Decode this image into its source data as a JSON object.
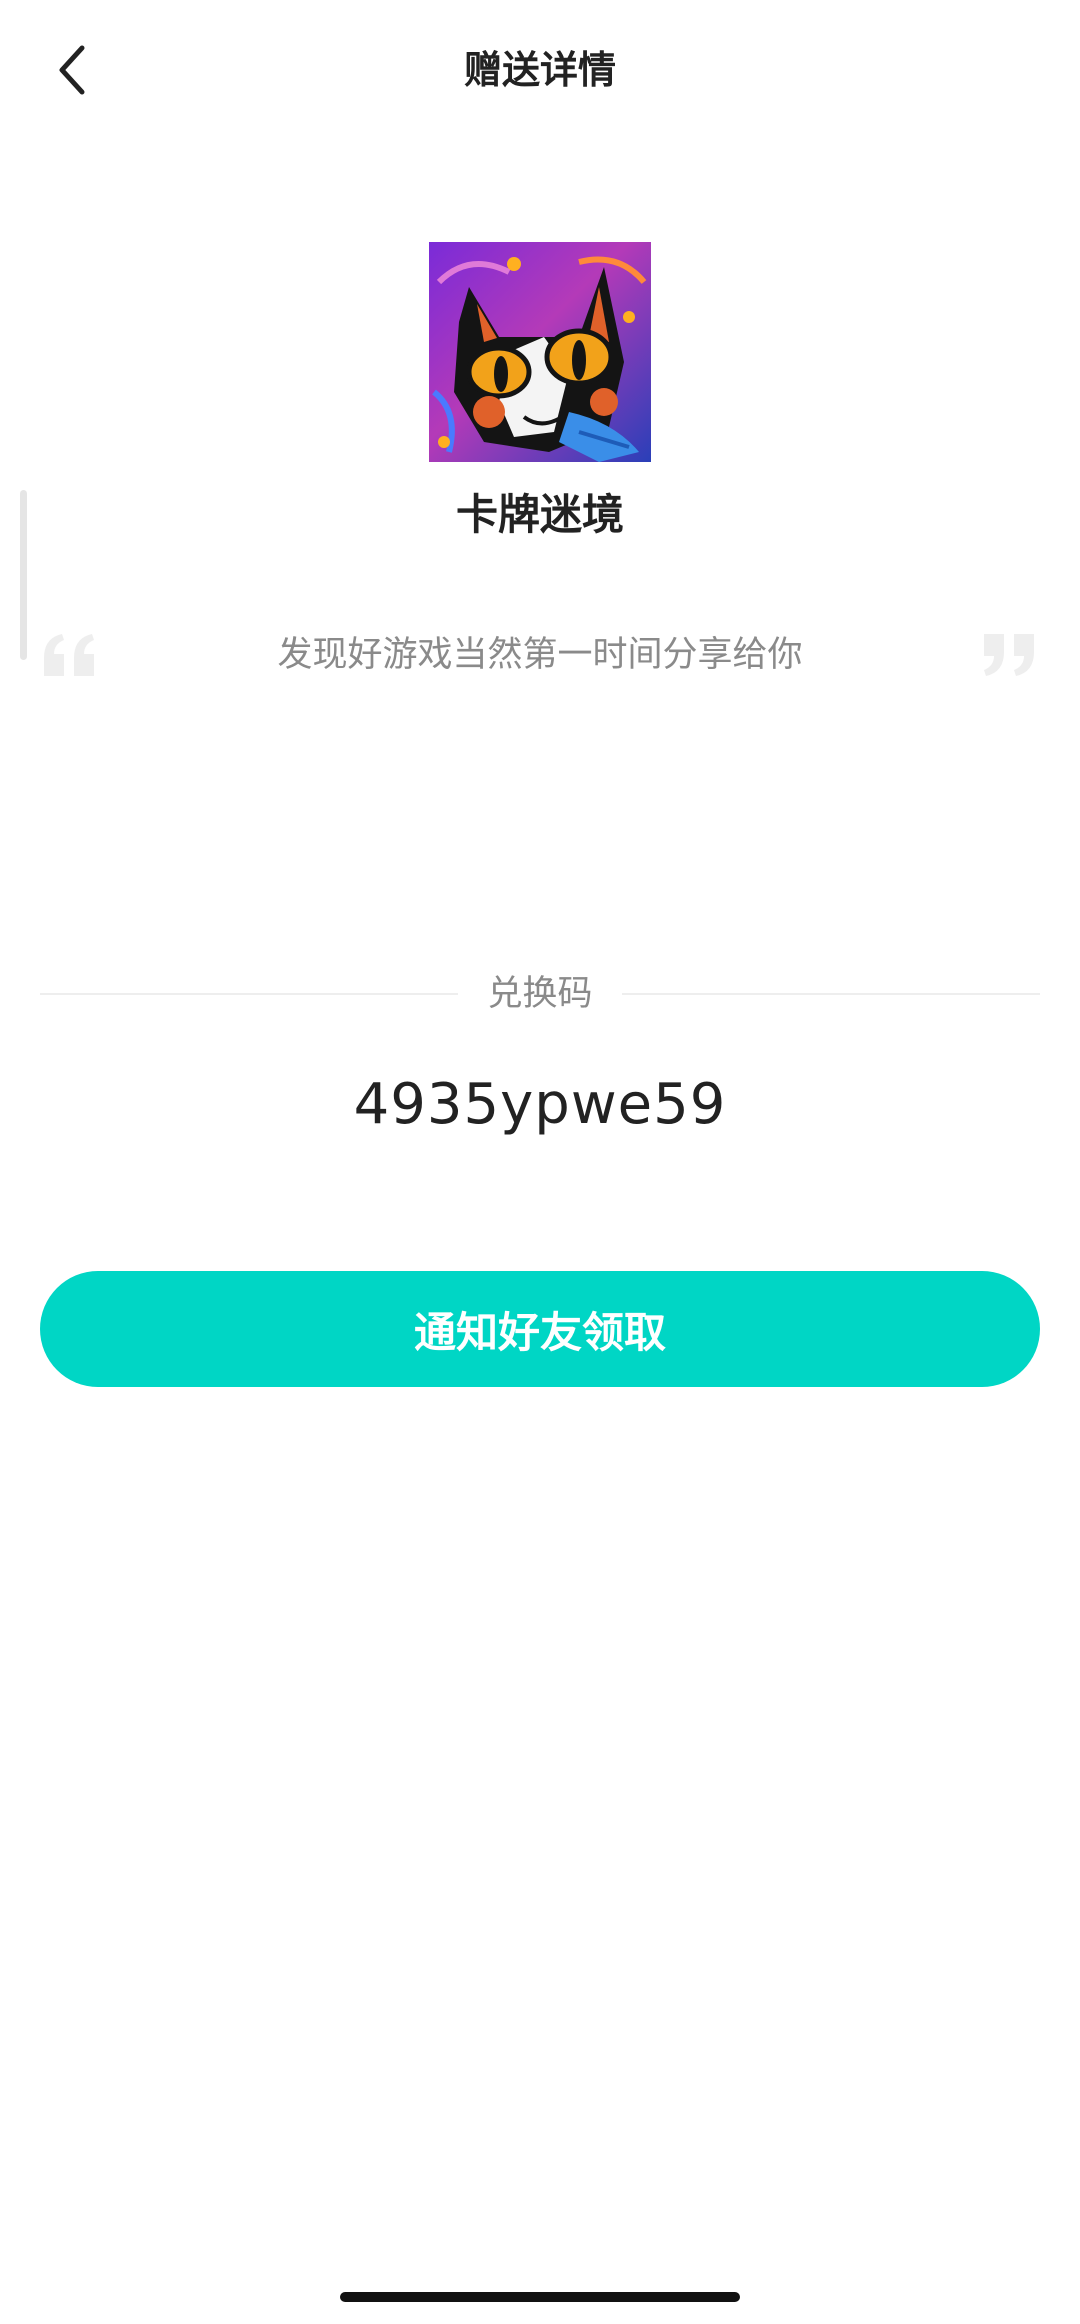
{
  "header": {
    "title": "赠送详情",
    "back_icon": "chevron-left-icon"
  },
  "game": {
    "icon": "game-icon",
    "name": "卡牌迷境"
  },
  "quote": {
    "text": "发现好游戏当然第一时间分享给你",
    "open_icon": "quote-open-icon",
    "close_icon": "quote-close-icon"
  },
  "redeem": {
    "label": "兑换码",
    "code": "4935ypwe59"
  },
  "actions": {
    "notify_label": "通知好友领取"
  },
  "colors": {
    "accent": "#00d6c5",
    "text_primary": "#222222",
    "text_secondary": "#8a8a8a",
    "divider": "#eeeeee"
  }
}
